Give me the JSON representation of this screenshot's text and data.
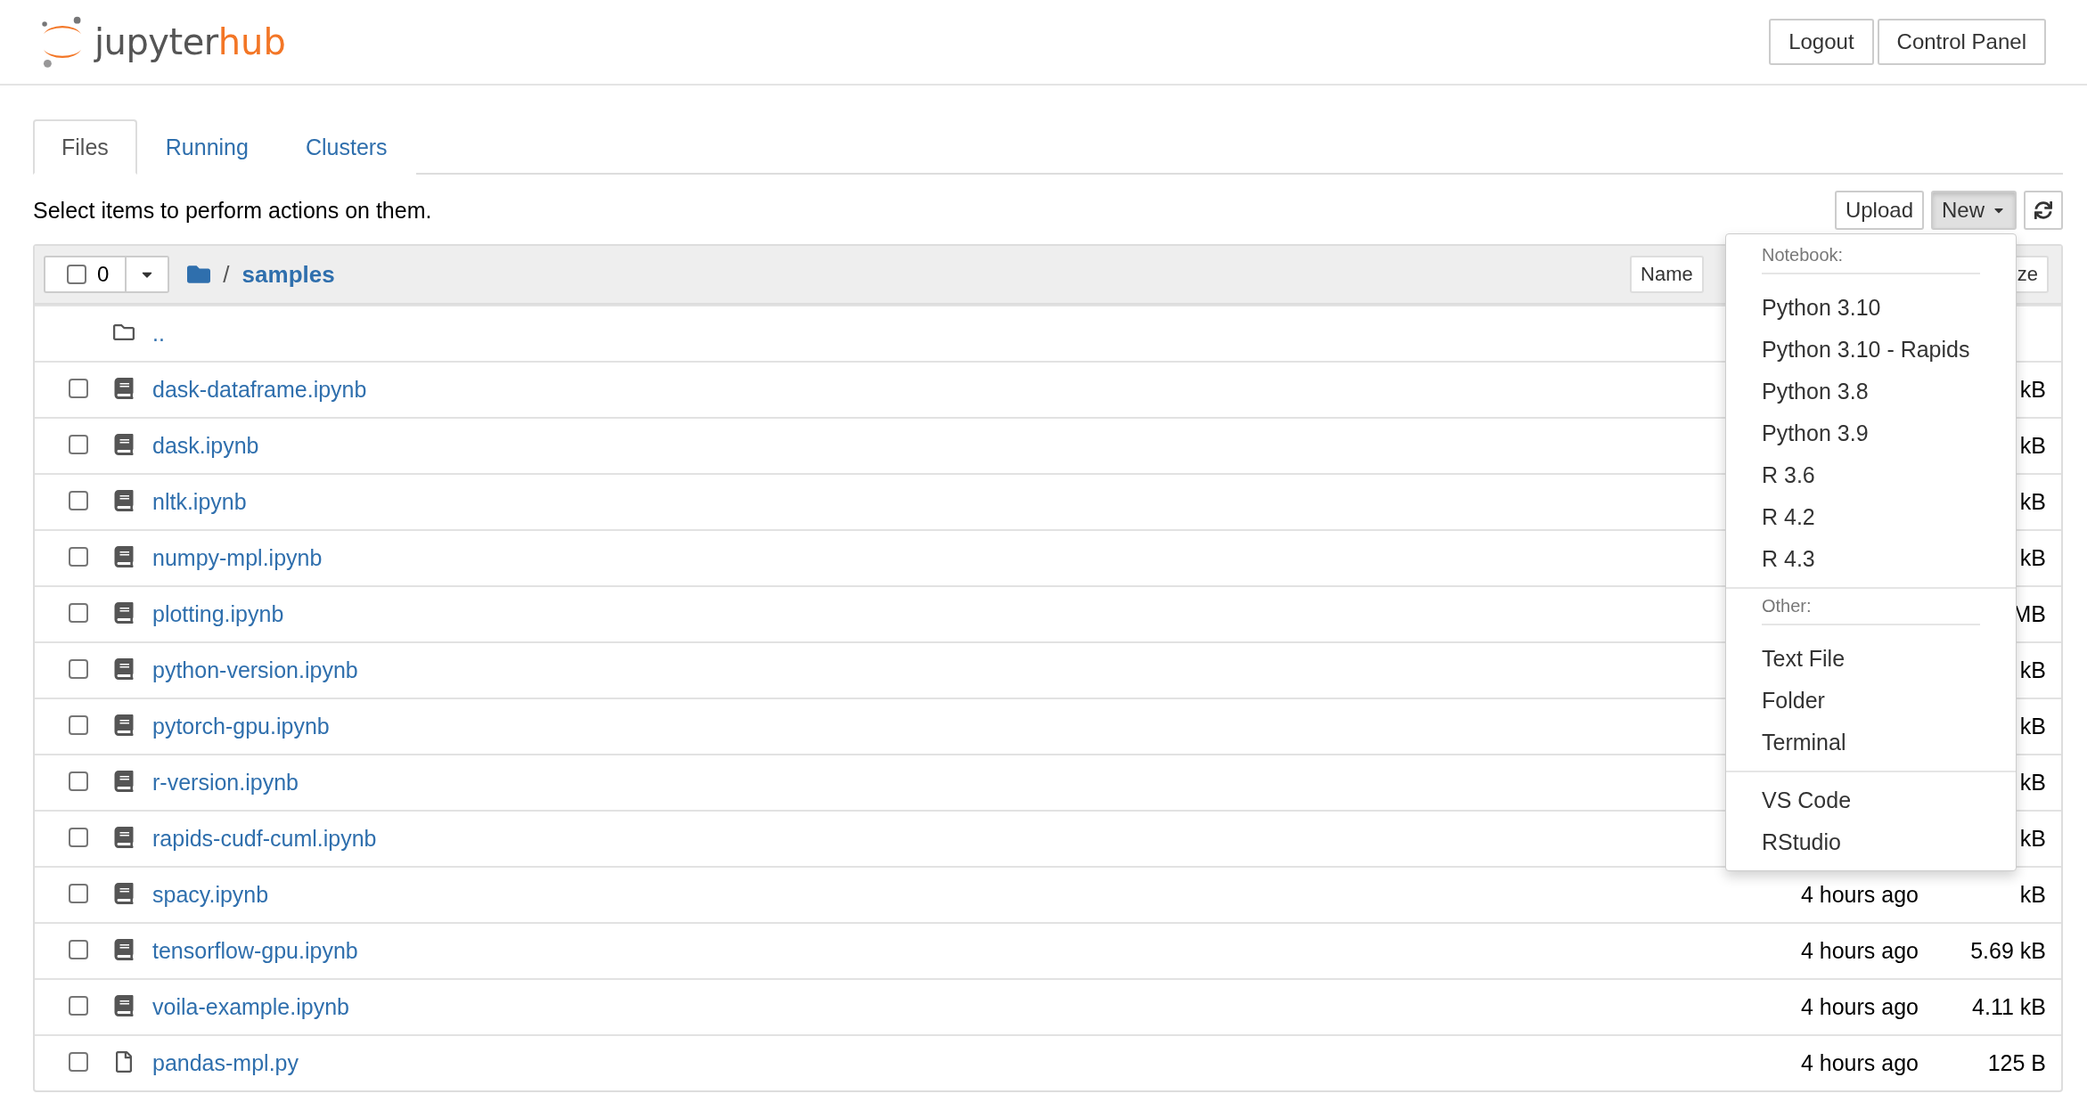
{
  "header": {
    "logo": {
      "text_main": "jupyter",
      "text_accent": "hub"
    },
    "buttons": [
      "Logout",
      "Control Panel"
    ]
  },
  "tabs": [
    {
      "label": "Files",
      "selected": true
    },
    {
      "label": "Running",
      "selected": false
    },
    {
      "label": "Clusters",
      "selected": false
    }
  ],
  "hint": "Select items to perform actions on them.",
  "toolbar": {
    "upload": "Upload",
    "new": {
      "label": "New",
      "open": true
    },
    "new_menu": [
      {
        "kind": "header",
        "label": "Notebook:"
      },
      {
        "kind": "item",
        "label": "Python 3.10"
      },
      {
        "kind": "item",
        "label": "Python 3.10 - Rapids"
      },
      {
        "kind": "item",
        "label": "Python 3.8"
      },
      {
        "kind": "item",
        "label": "Python 3.9"
      },
      {
        "kind": "item",
        "label": "R 3.6"
      },
      {
        "kind": "item",
        "label": "R 4.2"
      },
      {
        "kind": "item",
        "label": "R 4.3"
      },
      {
        "kind": "divider"
      },
      {
        "kind": "header",
        "label": "Other:"
      },
      {
        "kind": "item",
        "label": "Text File"
      },
      {
        "kind": "item",
        "label": "Folder"
      },
      {
        "kind": "item",
        "label": "Terminal"
      },
      {
        "kind": "divider"
      },
      {
        "kind": "item",
        "label": "VS Code"
      },
      {
        "kind": "item",
        "label": "RStudio"
      }
    ]
  },
  "file_list": {
    "select_all": {
      "checked": false,
      "count": "0"
    },
    "breadcrumb": {
      "separator": "/",
      "folder": "samples"
    },
    "sort_buttons": [
      "Name",
      "ze"
    ],
    "rows": [
      {
        "kind": "parent",
        "name": ".."
      },
      {
        "kind": "notebook",
        "name": "dask-dataframe.ipynb",
        "checked": false,
        "size": "kB"
      },
      {
        "kind": "notebook",
        "name": "dask.ipynb",
        "checked": false,
        "size": "kB"
      },
      {
        "kind": "notebook",
        "name": "nltk.ipynb",
        "checked": false,
        "size": "kB"
      },
      {
        "kind": "notebook",
        "name": "numpy-mpl.ipynb",
        "checked": false,
        "size": "kB"
      },
      {
        "kind": "notebook",
        "name": "plotting.ipynb",
        "checked": false,
        "size": "MB"
      },
      {
        "kind": "notebook",
        "name": "python-version.ipynb",
        "checked": false,
        "size": "kB"
      },
      {
        "kind": "notebook",
        "name": "pytorch-gpu.ipynb",
        "checked": false,
        "size": "kB"
      },
      {
        "kind": "notebook",
        "name": "r-version.ipynb",
        "checked": false,
        "size": "kB"
      },
      {
        "kind": "notebook",
        "name": "rapids-cudf-cuml.ipynb",
        "checked": false,
        "size": "kB"
      },
      {
        "kind": "notebook",
        "name": "spacy.ipynb",
        "checked": false,
        "modified": "4 hours ago",
        "size": "kB"
      },
      {
        "kind": "notebook",
        "name": "tensorflow-gpu.ipynb",
        "checked": false,
        "modified": "4 hours ago",
        "size": "5.69 kB"
      },
      {
        "kind": "notebook",
        "name": "voila-example.ipynb",
        "checked": false,
        "modified": "4 hours ago",
        "size": "4.11 kB"
      },
      {
        "kind": "file",
        "name": "pandas-mpl.py",
        "checked": false,
        "modified": "4 hours ago",
        "size": "125 B"
      }
    ]
  }
}
